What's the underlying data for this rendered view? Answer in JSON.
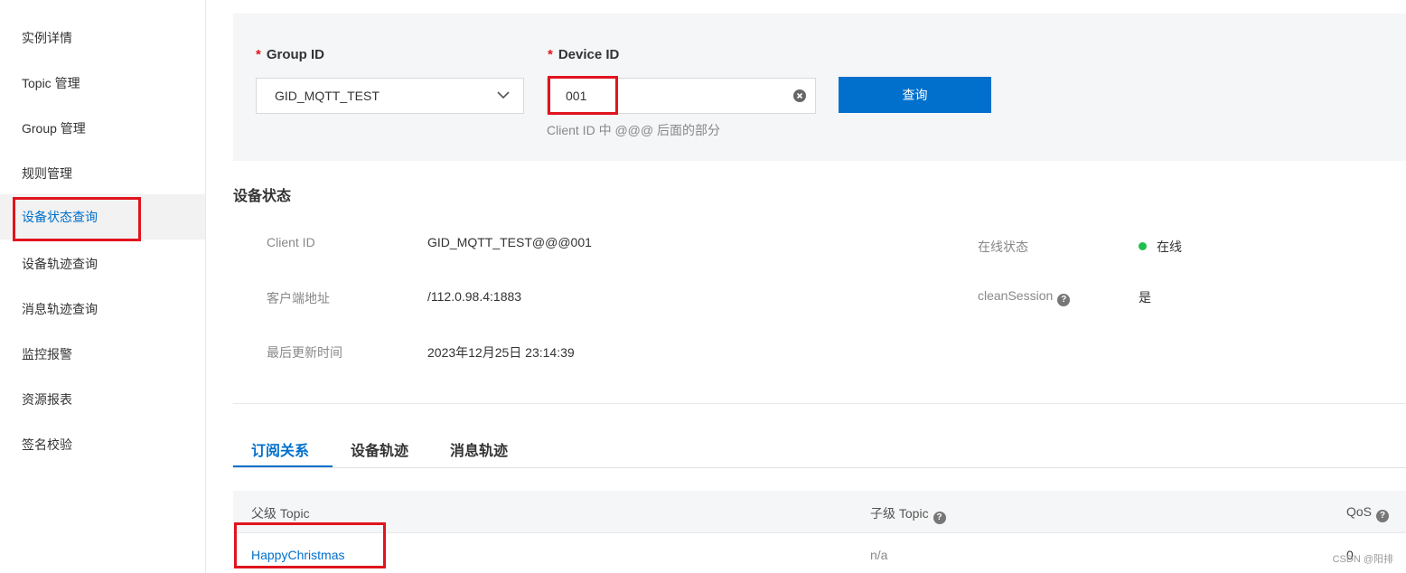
{
  "sidebar": {
    "items": [
      {
        "label": "实例详情"
      },
      {
        "label": "Topic 管理"
      },
      {
        "label": "Group 管理"
      },
      {
        "label": "规则管理"
      },
      {
        "label": "设备状态查询"
      },
      {
        "label": "设备轨迹查询"
      },
      {
        "label": "消息轨迹查询"
      },
      {
        "label": "监控报警"
      },
      {
        "label": "资源报表"
      },
      {
        "label": "签名校验"
      }
    ],
    "active_index": 4
  },
  "query": {
    "required_mark": "*",
    "group_label": "Group ID",
    "group_value": "GID_MQTT_TEST",
    "device_label": "Device ID",
    "device_value": "001",
    "device_hint": "Client ID 中 @@@ 后面的部分",
    "query_button": "查询"
  },
  "status": {
    "title": "设备状态",
    "client_id_label": "Client ID",
    "client_id_value": "GID_MQTT_TEST@@@001",
    "address_label": "客户端地址",
    "address_value": "/112.0.98.4:1883",
    "updated_label": "最后更新时间",
    "updated_value": "2023年12月25日 23:14:39",
    "online_label": "在线状态",
    "online_value": "在线",
    "online_color": "#1ebf4a",
    "clean_session_label": "cleanSession",
    "clean_session_value": "是"
  },
  "tabs": [
    {
      "label": "订阅关系",
      "active": true
    },
    {
      "label": "设备轨迹",
      "active": false
    },
    {
      "label": "消息轨迹",
      "active": false
    }
  ],
  "table": {
    "headers": {
      "parent_topic": "父级 Topic",
      "sub_topic": "子级 Topic",
      "qos": "QoS"
    },
    "rows": [
      {
        "parent_topic": "HappyChristmas",
        "sub_topic": "n/a",
        "qos": "0"
      }
    ]
  },
  "watermark": "CSDN @阳排",
  "colors": {
    "accent": "#0070cc",
    "highlight_box": "#e0141e"
  }
}
